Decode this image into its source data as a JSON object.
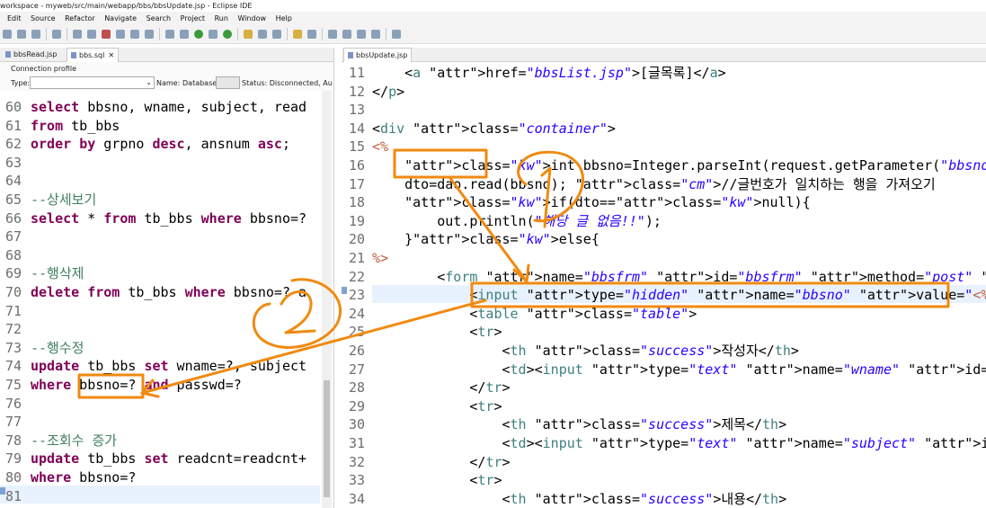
{
  "window": {
    "title": "workspace - myweb/src/main/webapp/bbs/bbsUpdate.jsp - Eclipse IDE"
  },
  "menu": [
    "Edit",
    "Source",
    "Refactor",
    "Navigate",
    "Search",
    "Project",
    "Run",
    "Window",
    "Help"
  ],
  "left": {
    "tabs": [
      {
        "label": "bbsRead.jsp"
      },
      {
        "label": "bbs.sql"
      }
    ],
    "close_glyph": "✕",
    "profile": {
      "title": "Connection profile",
      "type_label": "Type:",
      "name_label": "Name:",
      "database_label": "Database:",
      "status": "Status: Disconnected, Auto"
    },
    "lines": [
      {
        "n": "60",
        "t": "select bbsno, wname, subject, read"
      },
      {
        "n": "61",
        "t": "from tb_bbs"
      },
      {
        "n": "62",
        "t": "order by grpno desc, ansnum asc;"
      },
      {
        "n": "63",
        "t": ""
      },
      {
        "n": "64",
        "t": ""
      },
      {
        "n": "65",
        "t": "--상세보기"
      },
      {
        "n": "66",
        "t": "select * from tb_bbs where bbsno=?"
      },
      {
        "n": "67",
        "t": ""
      },
      {
        "n": "68",
        "t": ""
      },
      {
        "n": "69",
        "t": "--행삭제"
      },
      {
        "n": "70",
        "t": "delete from tb_bbs where bbsno=? a"
      },
      {
        "n": "71",
        "t": ""
      },
      {
        "n": "72",
        "t": ""
      },
      {
        "n": "73",
        "t": "--행수정"
      },
      {
        "n": "74",
        "t": "update tb_bbs set wname=?, subject"
      },
      {
        "n": "75",
        "t": "where bbsno=? and passwd=?"
      },
      {
        "n": "76",
        "t": ""
      },
      {
        "n": "77",
        "t": ""
      },
      {
        "n": "78",
        "t": "--조회수 증가"
      },
      {
        "n": "79",
        "t": "update tb_bbs set readcnt=readcnt+"
      },
      {
        "n": "80",
        "t": "where bbsno=?"
      },
      {
        "n": "81",
        "t": ""
      }
    ]
  },
  "right": {
    "tab": {
      "label": "bbsUpdate.jsp"
    },
    "lines": [
      {
        "n": "11",
        "t": "    <a href=\"bbsList.jsp\">[글목록]</a>"
      },
      {
        "n": "12",
        "t": "</p>"
      },
      {
        "n": "13",
        "t": ""
      },
      {
        "n": "14",
        "t": "<div class=\"container\">"
      },
      {
        "n": "15",
        "t": "<%"
      },
      {
        "n": "16",
        "t": "    int bbsno=Integer.parseInt(request.getParameter(\"bbsno\"));//수정 글번"
      },
      {
        "n": "17",
        "t": "    dto=dao.read(bbsno); //글번호가 일치하는 행을 가져오기"
      },
      {
        "n": "18",
        "t": "    if(dto==null){"
      },
      {
        "n": "19",
        "t": "        out.println(\"해당 글 없음!!\");"
      },
      {
        "n": "20",
        "t": "    }else{"
      },
      {
        "n": "21",
        "t": "%>"
      },
      {
        "n": "22",
        "t": "        <form name=\"bbsfrm\" id=\"bbsfrm\" method=\"post\" action=\"bbsUpdate"
      },
      {
        "n": "23",
        "t": "            <input type=\"hidden\" name=\"bbsno\" value=\"<%=bbsno%>\">"
      },
      {
        "n": "24",
        "t": "            <table class=\"table\">"
      },
      {
        "n": "25",
        "t": "            <tr>"
      },
      {
        "n": "26",
        "t": "                <th class=\"success\">작성자</th>"
      },
      {
        "n": "27",
        "t": "                <td><input type=\"text\" name=\"wname\" id=\"wname\" value=\"<%"
      },
      {
        "n": "28",
        "t": "            </tr>"
      },
      {
        "n": "29",
        "t": "            <tr>"
      },
      {
        "n": "30",
        "t": "                <th class=\"success\">제목</th>"
      },
      {
        "n": "31",
        "t": "                <td><input type=\"text\" name=\"subject\" id=\"subject\" value"
      },
      {
        "n": "32",
        "t": "            </tr>"
      },
      {
        "n": "33",
        "t": "            <tr>"
      },
      {
        "n": "34",
        "t": "                <th class=\"success\">내용</th>"
      }
    ]
  },
  "annotation_color": "#f08a10"
}
